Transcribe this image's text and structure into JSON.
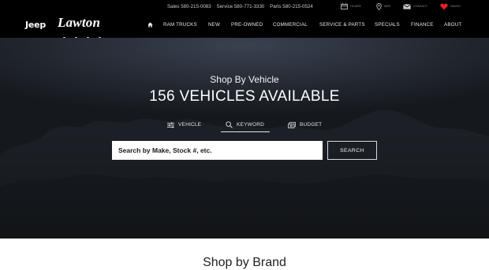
{
  "brand": {
    "jeep": "Jeep",
    "lawton": "Lawton"
  },
  "phones": {
    "sales": "Sales 580-215-0083",
    "service": "Service 580-771-3330",
    "parts": "Parts 580-215-0524"
  },
  "utility": {
    "hours": "HOURS",
    "map": "MAP",
    "contact": "CONTACT",
    "saved": "SAVED"
  },
  "nav": [
    "RAM TRUCKS",
    "NEW",
    "PRE-OWNED",
    "COMMERCIAL",
    "SERVICE & PARTS",
    "SPECIALS",
    "FINANCE",
    "ABOUT"
  ],
  "hero": {
    "subtitle": "Shop By Vehicle",
    "title": "156 VEHICLES AVAILABLE"
  },
  "tabs": {
    "vehicle": "VEHICLE",
    "keyword": "KEYWORD",
    "budget": "BUDGET"
  },
  "search": {
    "placeholder": "Search by Make, Stock #, etc.",
    "button": "SEARCH"
  },
  "sections": {
    "brand_heading": "Shop by Brand"
  },
  "colors": {
    "topbar": "#000000",
    "hero_sky": "#3a4150",
    "saved_heart": "#e0202a"
  }
}
